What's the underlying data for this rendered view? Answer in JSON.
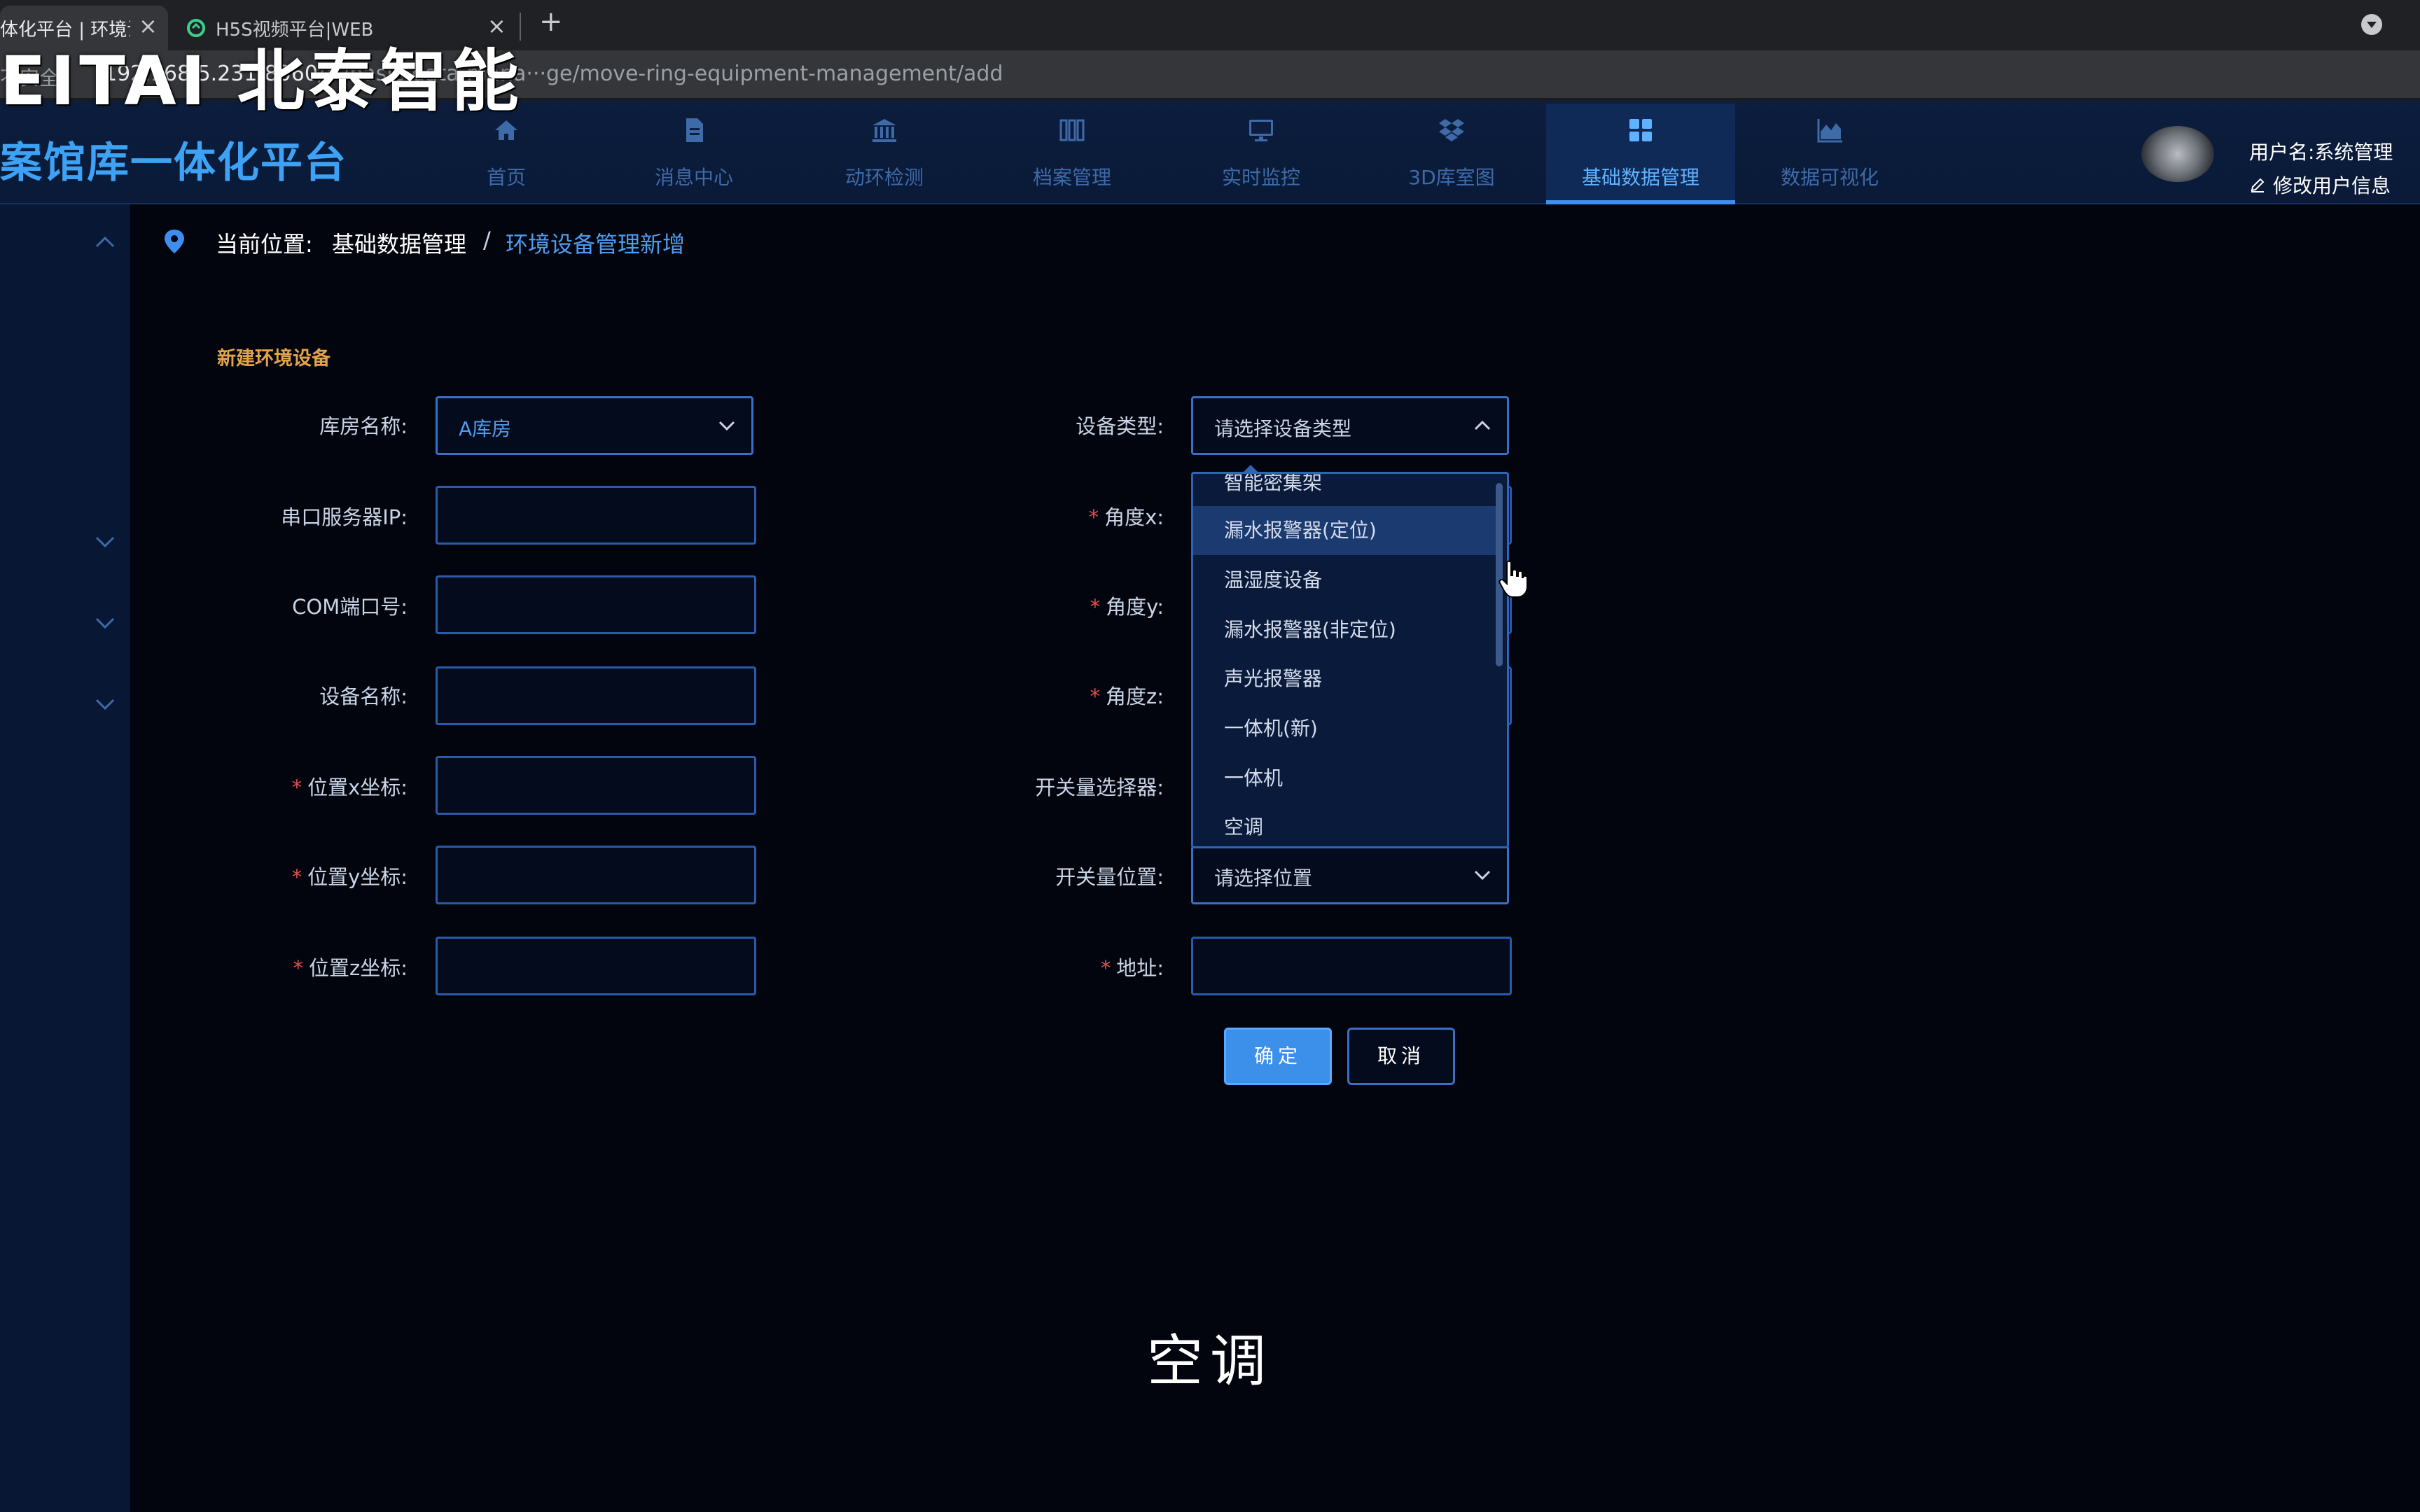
{
  "browser": {
    "tabs": [
      {
        "title": "体化平台 | 环境设",
        "active": true
      },
      {
        "title": "H5S视频平台|WEB",
        "active": false
      }
    ],
    "new_tab_label": "+",
    "close_label": "×",
    "address": {
      "security_label": "不安全",
      "host": "192.168.5.231:8060",
      "path": "/#/basic-data-management/move-ring-equipment-management/add",
      "display_path": "/#/basic-data-mana···ge/move-ring-equipment-management/add"
    }
  },
  "watermark": "EITAI 北泰智能",
  "app": {
    "title": "案馆库一体化平台",
    "nav": [
      {
        "label": "首页",
        "icon": "home-icon"
      },
      {
        "label": "消息中心",
        "icon": "document-icon"
      },
      {
        "label": "动环检测",
        "icon": "bank-icon"
      },
      {
        "label": "档案管理",
        "icon": "archive-icon"
      },
      {
        "label": "实时监控",
        "icon": "monitor-icon"
      },
      {
        "label": "3D库室图",
        "icon": "dropbox-icon"
      },
      {
        "label": "基础数据管理",
        "icon": "grid-icon",
        "active": true
      },
      {
        "label": "数据可视化",
        "icon": "area-chart-icon"
      }
    ],
    "user": {
      "label": "用户名:系统管理",
      "edit_label": "修改用户信息"
    }
  },
  "breadcrumb": {
    "label": "当前位置:",
    "section": "基础数据管理",
    "separator": "/",
    "page": "环境设备管理新增"
  },
  "form": {
    "title": "新建环境设备",
    "left_fields": [
      {
        "label": "库房名称:",
        "type": "select",
        "value": "A库房"
      },
      {
        "label": "串口服务器IP:",
        "type": "input",
        "value": ""
      },
      {
        "label": "COM端口号:",
        "type": "input",
        "value": ""
      },
      {
        "label": "设备名称:",
        "type": "input",
        "value": ""
      },
      {
        "label": "位置x坐标:",
        "type": "input",
        "required": true,
        "value": ""
      },
      {
        "label": "位置y坐标:",
        "type": "input",
        "required": true,
        "value": ""
      },
      {
        "label": "位置z坐标:",
        "type": "input",
        "required": true,
        "value": ""
      }
    ],
    "right_fields": [
      {
        "label": "设备类型:",
        "type": "select",
        "placeholder": "请选择设备类型",
        "open": true
      },
      {
        "label": "角度x:",
        "required": true,
        "type": "input",
        "value": ""
      },
      {
        "label": "角度y:",
        "required": true,
        "type": "input",
        "value": ""
      },
      {
        "label": "角度z:",
        "required": true,
        "type": "input",
        "value": ""
      },
      {
        "label": "开关量选择器:",
        "type": "input",
        "value": ""
      },
      {
        "label": "开关量位置:",
        "type": "select",
        "placeholder": "请选择位置"
      },
      {
        "label": "地址:",
        "required": true,
        "type": "input",
        "value": ""
      }
    ],
    "device_type_options": [
      "智能密集架",
      "漏水报警器(定位)",
      "温湿度设备",
      "漏水报警器(非定位)",
      "声光报警器",
      "一体机(新)",
      "一体机",
      "空调"
    ],
    "hovered_option": "漏水报警器(定位)",
    "required_mark": "*",
    "confirm_label": "确定",
    "cancel_label": "取消"
  },
  "caption": "空调",
  "colors": {
    "accent": "#3d90ea",
    "title_blue": "#3da2f5",
    "section_title": "#e3a34b",
    "required": "#e0504f",
    "background": "#02050d"
  }
}
